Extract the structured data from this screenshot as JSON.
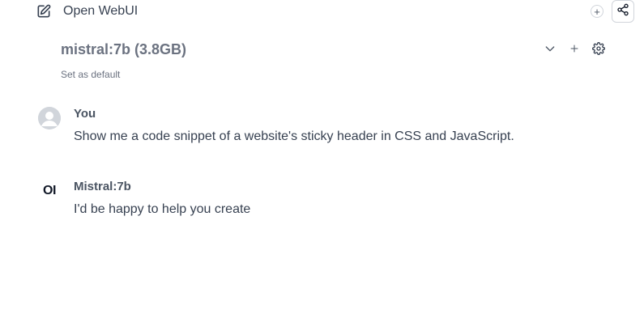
{
  "header": {
    "new_chat_label": "Open WebUI",
    "new_chat_icon": "edit-icon",
    "add_icon": "plus-circle-icon",
    "share_icon": "share-icon"
  },
  "model_selector": {
    "selected_model": "mistral:7b (3.8GB)",
    "set_default_label": "Set as default",
    "icons": [
      "chevron-down-icon",
      "plus-icon",
      "gear-icon"
    ]
  },
  "messages": [
    {
      "role": "user",
      "author": "You",
      "text": "Show me a code snippet of a website's sticky header in CSS and JavaScript.",
      "avatar": "user-avatar"
    },
    {
      "role": "assistant",
      "author": "Mistral:7b",
      "avatar_text": "OI",
      "text": "I'd be happy to help you create"
    }
  ],
  "colors": {
    "text": "#374151",
    "muted": "#6b7280",
    "border": "#d1d5db"
  }
}
